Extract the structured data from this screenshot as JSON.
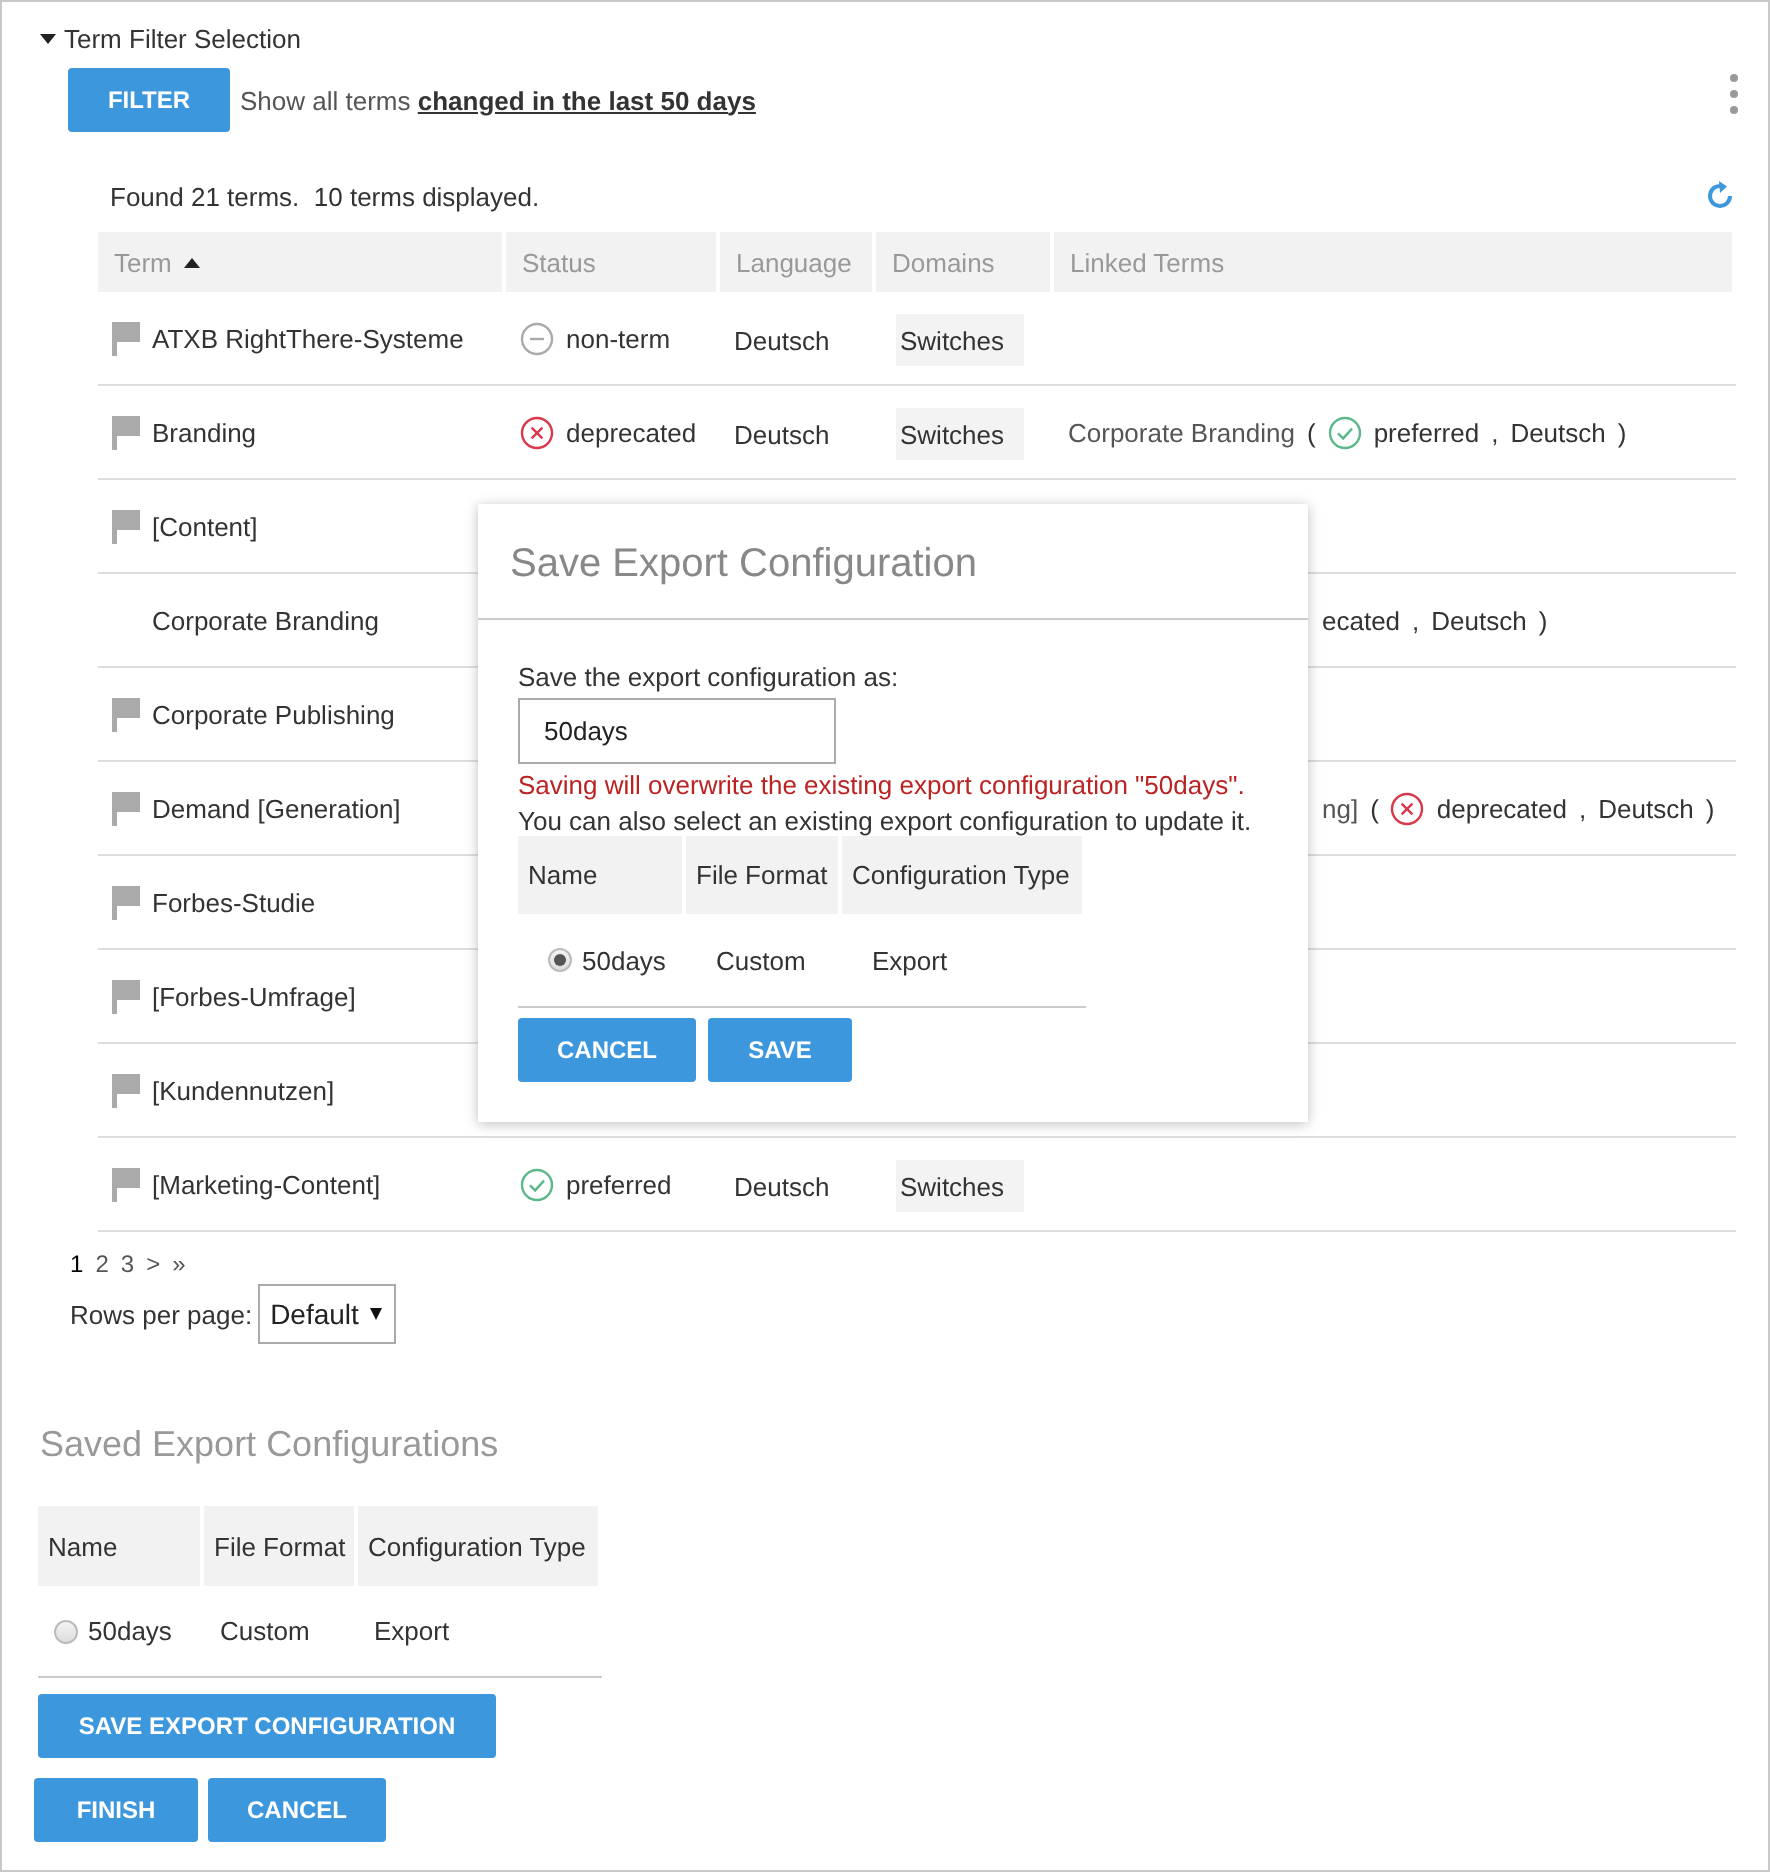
{
  "section": {
    "title": "Term Filter Selection",
    "expanded": true
  },
  "filter": {
    "button": "FILTER",
    "text": "Show all terms",
    "link": "changed in the last 50 days"
  },
  "summary": "Found 21 terms.  10 terms displayed.",
  "table": {
    "columns": [
      {
        "label": "Term",
        "sorted": true
      },
      {
        "label": "Status",
        "sorted": false
      },
      {
        "label": "Language",
        "sorted": false
      },
      {
        "label": "Domains",
        "sorted": false
      },
      {
        "label": "Linked Terms",
        "sorted": false
      }
    ],
    "rows": [
      {
        "flag": true,
        "term": "ATXB RightThere-Systeme",
        "status": {
          "kind": "non-term",
          "text": "non-term"
        },
        "language": "Deutsch",
        "domain": "Switches",
        "linked_cut": false,
        "linked": []
      },
      {
        "flag": true,
        "term": "Branding",
        "status": {
          "kind": "deprecated",
          "text": "deprecated"
        },
        "language": "Deutsch",
        "domain": "Switches",
        "linked_cut": false,
        "linked": [
          {
            "kind": "term",
            "text": "Corporate Branding"
          },
          {
            "kind": "punct",
            "text": "("
          },
          {
            "kind": "status",
            "status": {
              "kind": "preferred"
            },
            "text": "preferred"
          },
          {
            "kind": "punct",
            "text": ","
          },
          {
            "kind": "text",
            "text": "Deutsch"
          },
          {
            "kind": "punct",
            "text": ")"
          }
        ]
      },
      {
        "flag": true,
        "term": "[Content]",
        "linked_cut": false,
        "linked": []
      },
      {
        "flag": false,
        "term": "Corporate Branding",
        "linked_cut": true,
        "linked": [
          {
            "kind": "text",
            "text": "ecated"
          },
          {
            "kind": "punct",
            "text": ","
          },
          {
            "kind": "text",
            "text": "Deutsch"
          },
          {
            "kind": "punct",
            "text": ")"
          }
        ]
      },
      {
        "flag": true,
        "term": "Corporate Publishing",
        "linked_cut": false,
        "linked": []
      },
      {
        "flag": true,
        "term": "Demand [Generation]",
        "linked_cut": true,
        "linked": [
          {
            "kind": "term",
            "text": "ng]"
          },
          {
            "kind": "punct",
            "text": "("
          },
          {
            "kind": "status",
            "status": {
              "kind": "deprecated"
            },
            "text": "deprecated"
          },
          {
            "kind": "punct",
            "text": ","
          },
          {
            "kind": "text",
            "text": "Deutsch"
          },
          {
            "kind": "punct",
            "text": ")"
          }
        ]
      },
      {
        "flag": true,
        "term": "Forbes-Studie",
        "linked_cut": false,
        "linked": []
      },
      {
        "flag": true,
        "term": "[Forbes-Umfrage]",
        "linked_cut": false,
        "linked": []
      },
      {
        "flag": true,
        "term": "[Kundennutzen]",
        "linked_cut": false,
        "linked": []
      },
      {
        "flag": true,
        "term": "[Marketing-Content]",
        "status": {
          "kind": "preferred",
          "text": "preferred"
        },
        "language": "Deutsch",
        "domain": "Switches",
        "linked_cut": false,
        "linked": []
      }
    ]
  },
  "pagination": [
    {
      "label": "1",
      "selected": true
    },
    {
      "label": "2",
      "selected": false
    },
    {
      "label": "3",
      "selected": false
    },
    {
      "label": ">",
      "selected": false
    },
    {
      "label": "»",
      "selected": false
    }
  ],
  "rows_per_page": {
    "label": "Rows per page:",
    "value": "Default"
  },
  "saved": {
    "title": "Saved Export Configurations",
    "columns": [
      "Name",
      "File Format",
      "Configuration Type"
    ],
    "rows": [
      {
        "name": "50days",
        "selected": false,
        "format": "Custom",
        "type": "Export"
      }
    ],
    "button": "SAVE EXPORT CONFIGURATION"
  },
  "footer_buttons": [
    "FINISH",
    "CANCEL"
  ],
  "dialog": {
    "title": "Save Export Configuration",
    "label": "Save the export configuration as:",
    "value": "50days",
    "warning": "Saving will overwrite the existing export configuration \"50days\".",
    "hint": "You can also select an existing export configuration to update it.",
    "columns": [
      "Name",
      "File Format",
      "Configuration Type"
    ],
    "rows": [
      {
        "name": "50days",
        "selected": true,
        "format": "Custom",
        "type": "Export"
      }
    ],
    "buttons": [
      "CANCEL",
      "SAVE"
    ]
  }
}
